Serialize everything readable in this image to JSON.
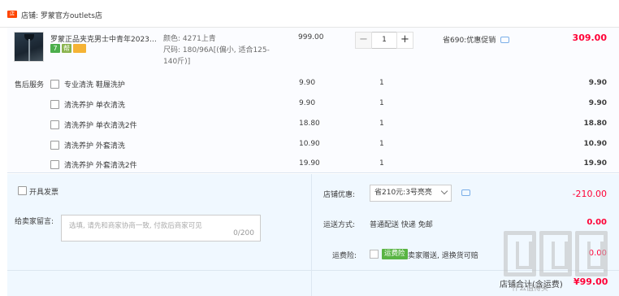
{
  "store": {
    "icon": "store-icon",
    "label": "店铺: 罗蒙官方outlets店"
  },
  "product": {
    "title": "罗蒙正品夹克男士中青年2023…",
    "badges": [
      "7",
      "帮",
      ""
    ],
    "sku_color": "颜色: 4271上青",
    "sku_size": "尺码: 180/96A[(偏小, 适合125-140斤)]",
    "unit_price": "999.00",
    "quantity": "1",
    "promo": "省690:优惠促销",
    "subtotal": "309.00"
  },
  "services": {
    "label": "售后服务",
    "items": [
      {
        "name": "专业清洗 鞋履洗护",
        "price": "9.90",
        "qty": "1",
        "total": "9.90"
      },
      {
        "name": "清洗养护 单衣清洗",
        "price": "9.90",
        "qty": "1",
        "total": "9.90"
      },
      {
        "name": "清洗养护 单衣清洗2件",
        "price": "18.80",
        "qty": "1",
        "total": "18.80"
      },
      {
        "name": "清洗养护 外套清洗",
        "price": "10.90",
        "qty": "1",
        "total": "10.90"
      },
      {
        "name": "清洗养护 外套清洗2件",
        "price": "19.90",
        "qty": "1",
        "total": "19.90"
      }
    ]
  },
  "invoice": {
    "label": "开具发票"
  },
  "message": {
    "label": "给卖家留言:",
    "placeholder": "选填, 请先和商家协商一致, 付款后商家可见",
    "counter": "0/200"
  },
  "coupon": {
    "label": "店铺优惠:",
    "selected": "省210元:3号亮亮",
    "discount": "-210.00"
  },
  "shipping": {
    "label": "运送方式:",
    "method": "普通配送 快递 免邮",
    "fee": "0.00"
  },
  "insurance": {
    "label": "运费险:",
    "badge": "运费险",
    "text": "卖家赠送, 退换货可赔",
    "fee": "0.00"
  },
  "total": {
    "label": "店铺合计(含运费)",
    "value": "¥99.00"
  },
  "watermark": {
    "text": "什么值得买"
  },
  "colors": {
    "accent": "#ff0036",
    "store_icon": "#ff4400",
    "panel": "#f0f8ff"
  }
}
